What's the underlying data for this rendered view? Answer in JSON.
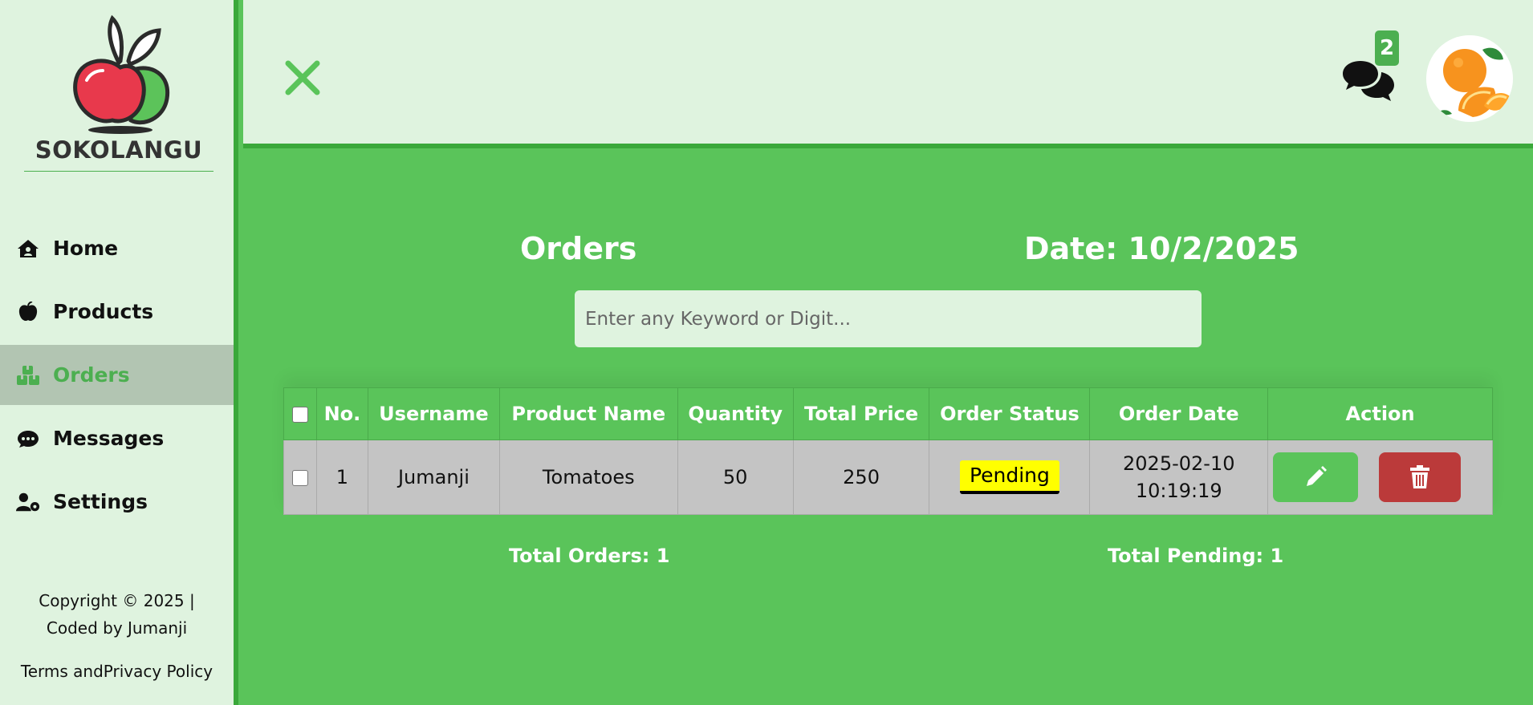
{
  "sidebar": {
    "brand": "SOKOLANGU",
    "items": [
      {
        "label": "Home",
        "icon": "home-icon"
      },
      {
        "label": "Products",
        "icon": "apple-icon"
      },
      {
        "label": "Orders",
        "icon": "boxes-icon",
        "active": true
      },
      {
        "label": "Messages",
        "icon": "chat-icon"
      },
      {
        "label": "Settings",
        "icon": "user-gear-icon"
      }
    ],
    "copyright_line1": "Copyright © 2025 |",
    "copyright_line2": "Coded by Jumanji",
    "terms": "Terms andPrivacy Policy"
  },
  "header": {
    "message_count": "2",
    "close_icon": "close-icon",
    "messages_icon": "chat-bubbles-icon"
  },
  "main": {
    "title": "Orders",
    "date": "Date: 10/2/2025",
    "search_placeholder": "Enter any Keyword or Digit...",
    "table": {
      "headers": [
        "No.",
        "Username",
        "Product Name",
        "Quantity",
        "Total Price",
        "Order Status",
        "Order Date",
        "Action"
      ],
      "rows": [
        {
          "no": "1",
          "username": "Jumanji",
          "product": "Tomatoes",
          "quantity": "50",
          "total_price": "250",
          "status": "Pending",
          "date_line1": "2025-02-10",
          "date_line2": "10:19:19"
        }
      ]
    },
    "total_orders": "Total Orders: 1",
    "total_pending": "Total Pending: 1"
  },
  "colors": {
    "accent": "#5ac45a",
    "light_bg": "#dff3df",
    "pending": "#ffff00",
    "delete": "#bb3a3a"
  }
}
